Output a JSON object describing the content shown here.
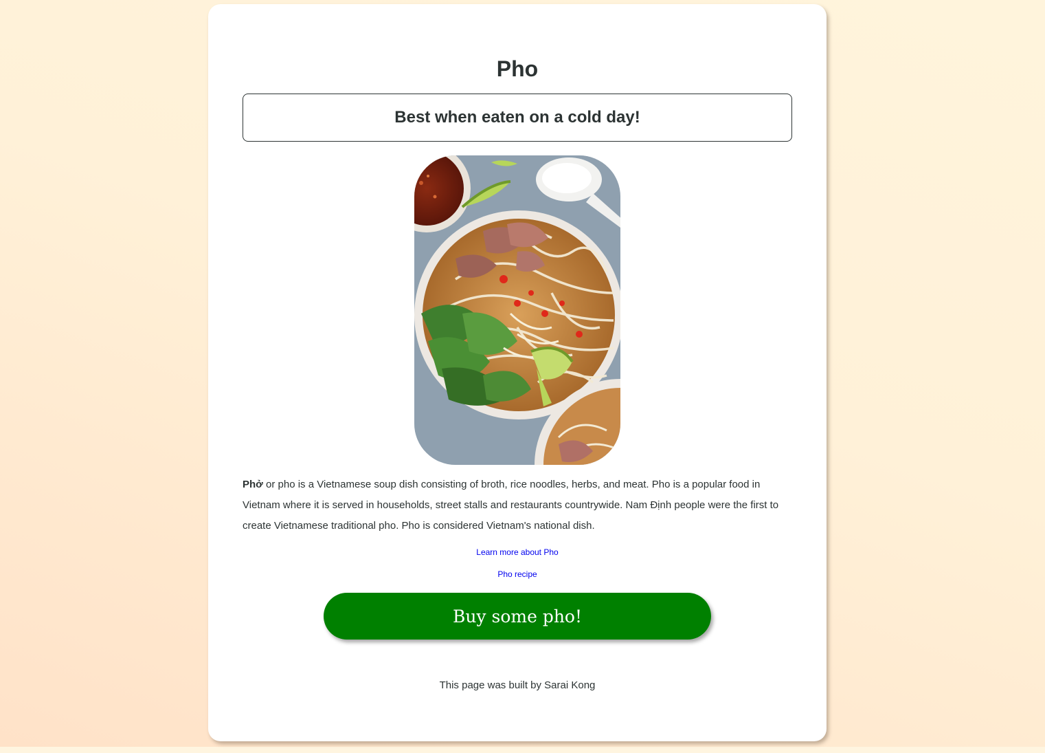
{
  "page": {
    "title": "Pho",
    "tagline": "Best when eaten on a cold day!",
    "image": {
      "icon": "pho-bowl-photo"
    },
    "description": {
      "bold_term": "Phở",
      "text": " or pho is a Vietnamese soup dish consisting of broth, rice noodles, herbs, and meat. Pho is a popular food in Vietnam where it is served in households, street stalls and restaurants countrywide. Nam Định people were the first to create Vietnamese traditional pho. Pho is considered Vietnam's national dish."
    },
    "links": [
      {
        "label": "Learn more about Pho"
      },
      {
        "label": "Pho recipe"
      }
    ],
    "buy_button": "Buy some pho!",
    "footer": "This page was built by Sarai Kong"
  },
  "colors": {
    "button": "#008000",
    "link": "#0000ee",
    "text": "#2c3333",
    "background_start": "#fff4dc",
    "background_end": "#ffe2c8"
  }
}
